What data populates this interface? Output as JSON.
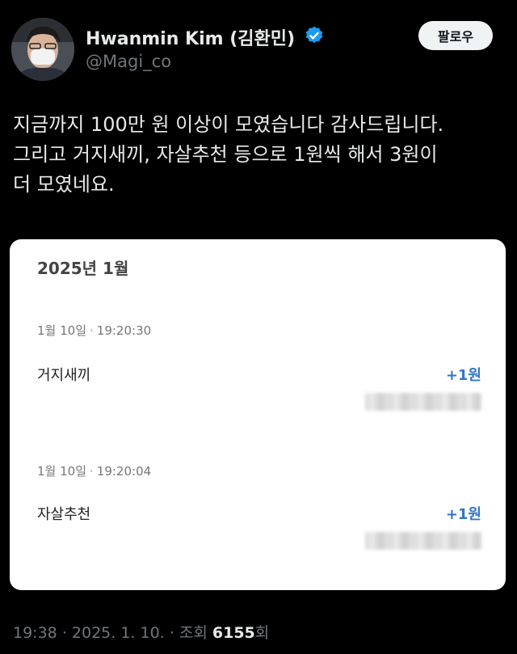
{
  "author": {
    "display_name": "Hwanmin Kim (김환민)",
    "handle": "@Magi_co",
    "verified_icon": "verified-badge-icon",
    "accent": "#1d9bf0"
  },
  "follow_button": {
    "label": "팔로우"
  },
  "tweet": {
    "lines": [
      "지금까지 100만 원 이상이 모였습니다 감사드립니다.",
      "그리고 거지새끼, 자살추천 등으로 1원씩 해서 3원이",
      "더 모였네요."
    ]
  },
  "card": {
    "month": "2025년 1월",
    "transactions": [
      {
        "date": "1월 10일",
        "sep": "·",
        "time": "19:20:30",
        "name": "거지새끼",
        "amount": "+1원"
      },
      {
        "date": "1월 10일",
        "sep": "·",
        "time": "19:20:04",
        "name": "자살추천",
        "amount": "+1원"
      }
    ]
  },
  "footer": {
    "time": "19:38",
    "sep1": "·",
    "date": "2025. 1. 10.",
    "sep2": "·",
    "views_label": "조회",
    "views_count": "6155",
    "views_suffix": "회"
  }
}
